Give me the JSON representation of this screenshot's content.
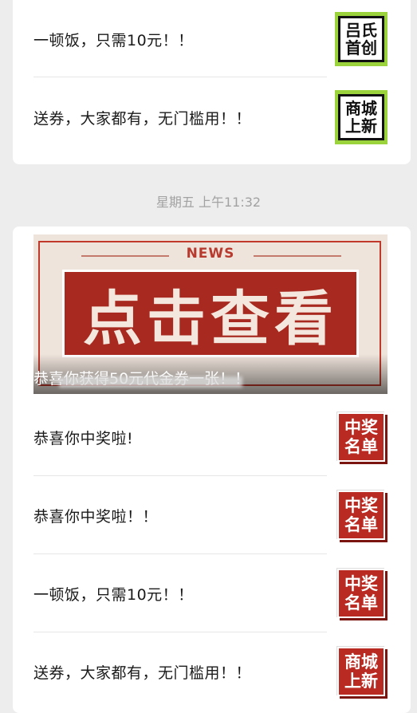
{
  "card1": {
    "items": [
      {
        "title": "一顿饭，只需10元！！",
        "thumb_text": "吕氏首创",
        "thumb_style": "green"
      },
      {
        "title": "送券，大家都有，无门槛用！！",
        "thumb_text": "商城上新",
        "thumb_style": "green"
      }
    ]
  },
  "timestamp": "星期五 上午11:32",
  "card2": {
    "banner": {
      "news_label": "NEWS",
      "headline": "点击查看",
      "overlay_title": "恭喜你获得50元代金券一张！！"
    },
    "items": [
      {
        "title": "恭喜你中奖啦!",
        "thumb_text": "中奖名单",
        "thumb_style": "red"
      },
      {
        "title": "恭喜你中奖啦！！",
        "thumb_text": "中奖名单",
        "thumb_style": "red"
      },
      {
        "title": "一顿饭，只需10元！！",
        "thumb_text": "中奖名单",
        "thumb_style": "red"
      },
      {
        "title": "送券，大家都有，无门槛用！！",
        "thumb_text": "商城上新",
        "thumb_style": "red"
      }
    ]
  },
  "colors": {
    "page_bg": "#ededed",
    "card_bg": "#ffffff",
    "green_thumb": "#9ad33b",
    "red_thumb": "#b92a23",
    "timestamp_text": "#a2a2a2"
  }
}
